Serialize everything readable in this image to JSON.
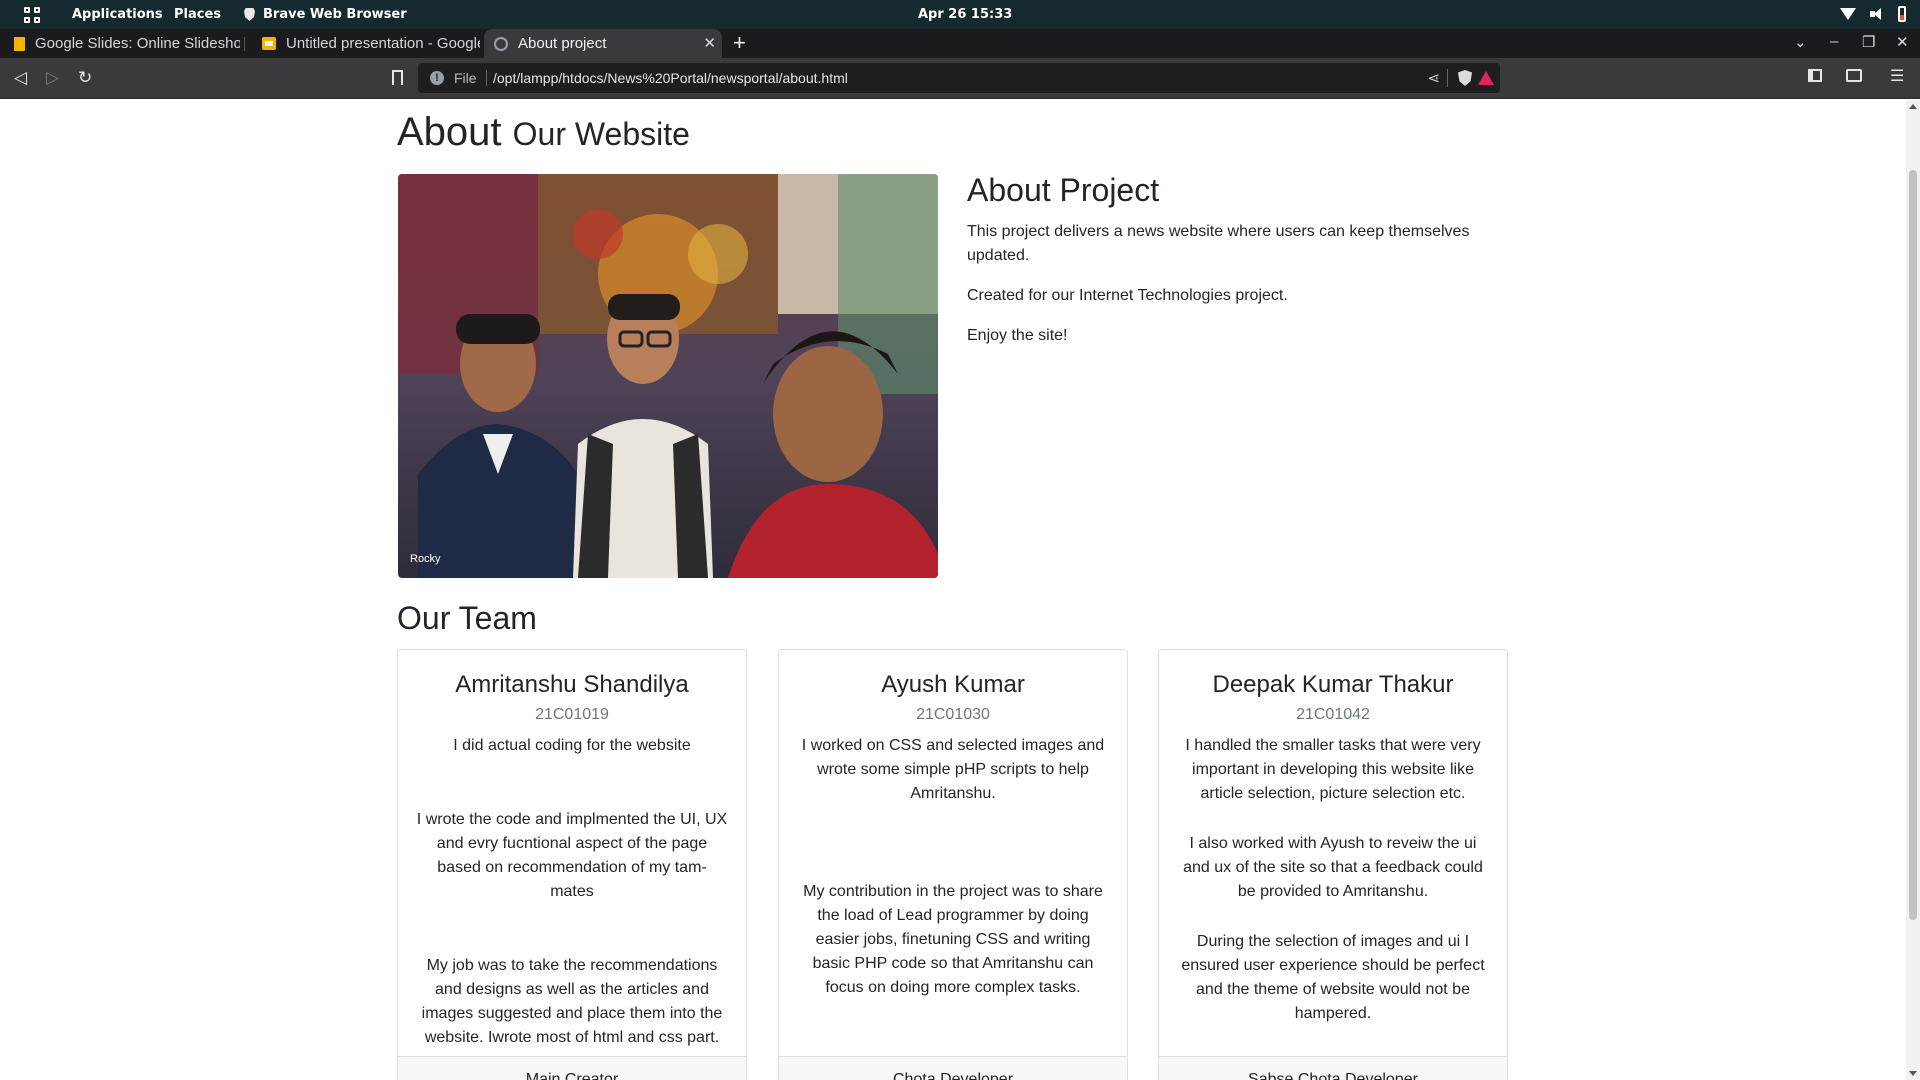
{
  "topbar": {
    "applications": "Applications",
    "places": "Places",
    "browser_name": "Brave Web Browser",
    "clock": "Apr 26  15:33"
  },
  "tabs": [
    {
      "label": "Google Slides: Online Slideshow Maker",
      "active": false
    },
    {
      "label": "Untitled presentation - Google Slides",
      "active": false
    },
    {
      "label": "About project",
      "active": true
    }
  ],
  "toolbar": {
    "scheme": "File",
    "url": "/opt/lampp/htdocs/News%20Portal/newsportal/about.html"
  },
  "page": {
    "about_main": "About",
    "about_sub": "Our Website",
    "photo_caption": "Rocky",
    "project_title": "About Project",
    "project_p1": "This project delivers a news website where users can keep themselves updated.",
    "project_p2": "Created for our Internet Technologies project.",
    "project_p3": "Enjoy the site!",
    "team_title": "Our Team"
  },
  "team": [
    {
      "name": "Amritanshu Shandilya",
      "roll": "21C01019",
      "p1": "I did actual coding for the website",
      "p2": "I wrote the code and implmented the UI, UX and evry fucntional aspect of the page based on recommendation of my tam-mates",
      "p3": "My job was to take the recommendations and designs as well as the articles and images suggested and place them into the website. Iwrote most of html and css part.",
      "role": "Main Creator"
    },
    {
      "name": "Ayush Kumar",
      "roll": "21C01030",
      "p1": "I worked on CSS and selected images and wrote some simple pHP scripts to help Amritanshu.",
      "p2": "My contribution in the project was to share the load of Lead programmer by doing easier jobs, finetuning CSS and writing basic PHP code so that Amritanshu can focus on doing more complex tasks.",
      "role": "Chota Developer"
    },
    {
      "name": "Deepak Kumar Thakur",
      "roll": "21C01042",
      "p1": "I handled the smaller tasks that were very important in developing this website like article selection, picture selection etc.",
      "p2": "I also worked with Ayush to reveiw the ui and ux of the site so that a feedback could be provided to Amritanshu.",
      "p3": "During the selection of images and ui I ensured user experience should be perfect and the theme of website would not be hampered.",
      "role": "Sabse Chota Developer"
    }
  ]
}
